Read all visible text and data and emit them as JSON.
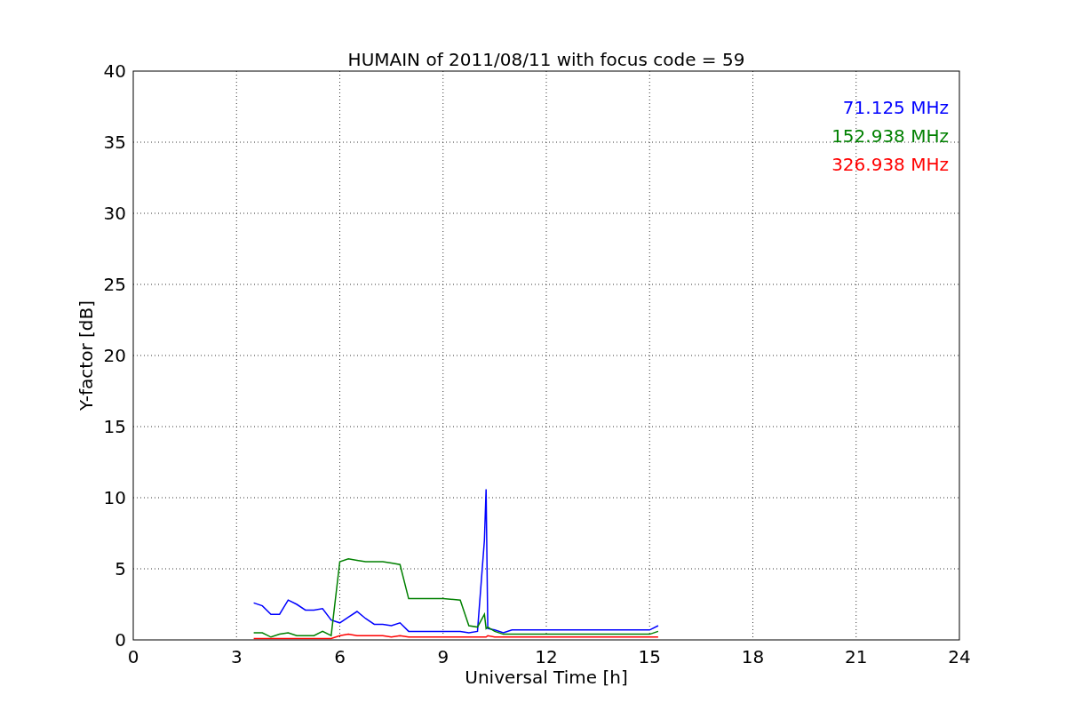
{
  "chart_data": {
    "type": "line",
    "title": "HUMAIN of 2011/08/11 with focus code = 59",
    "xlabel": "Universal Time [h]",
    "ylabel": "Y-factor [dB]",
    "xlim": [
      0,
      24
    ],
    "ylim": [
      0,
      40
    ],
    "xticks": [
      0,
      3,
      6,
      9,
      12,
      15,
      18,
      21,
      24
    ],
    "yticks": [
      0,
      5,
      10,
      15,
      20,
      25,
      30,
      35,
      40
    ],
    "grid": true,
    "x": [
      3.5,
      3.75,
      4.0,
      4.25,
      4.5,
      4.75,
      5.0,
      5.25,
      5.5,
      5.75,
      6.0,
      6.25,
      6.5,
      6.75,
      7.0,
      7.25,
      7.5,
      7.75,
      8.0,
      8.5,
      9.0,
      9.5,
      9.75,
      10.0,
      10.2,
      10.25,
      10.3,
      10.5,
      10.75,
      11.0,
      13.0,
      15.0,
      15.25
    ],
    "series": [
      {
        "name": "71.125 MHz",
        "color": "#0000ff",
        "values": [
          2.6,
          2.4,
          1.8,
          1.8,
          2.8,
          2.5,
          2.1,
          2.1,
          2.2,
          1.4,
          1.2,
          1.6,
          2.0,
          1.5,
          1.1,
          1.1,
          1.0,
          1.2,
          0.6,
          0.6,
          0.6,
          0.6,
          0.5,
          0.6,
          7.0,
          10.6,
          0.8,
          0.7,
          0.5,
          0.7,
          0.7,
          0.7,
          1.0
        ]
      },
      {
        "name": "152.938 MHz",
        "color": "#008000",
        "values": [
          0.5,
          0.5,
          0.2,
          0.4,
          0.5,
          0.3,
          0.3,
          0.3,
          0.6,
          0.3,
          5.5,
          5.7,
          5.6,
          5.5,
          5.5,
          5.5,
          5.4,
          5.3,
          2.9,
          2.9,
          2.9,
          2.8,
          1.0,
          0.9,
          1.8,
          0.8,
          0.9,
          0.6,
          0.4,
          0.4,
          0.4,
          0.4,
          0.6
        ]
      },
      {
        "name": "326.938 MHz",
        "color": "#ff0000",
        "values": [
          0.1,
          0.1,
          0.1,
          0.1,
          0.1,
          0.1,
          0.1,
          0.1,
          0.1,
          0.1,
          0.3,
          0.4,
          0.3,
          0.3,
          0.3,
          0.3,
          0.2,
          0.3,
          0.2,
          0.2,
          0.2,
          0.2,
          0.2,
          0.2,
          0.2,
          0.2,
          0.3,
          0.2,
          0.2,
          0.2,
          0.2,
          0.2,
          0.2
        ]
      }
    ]
  }
}
